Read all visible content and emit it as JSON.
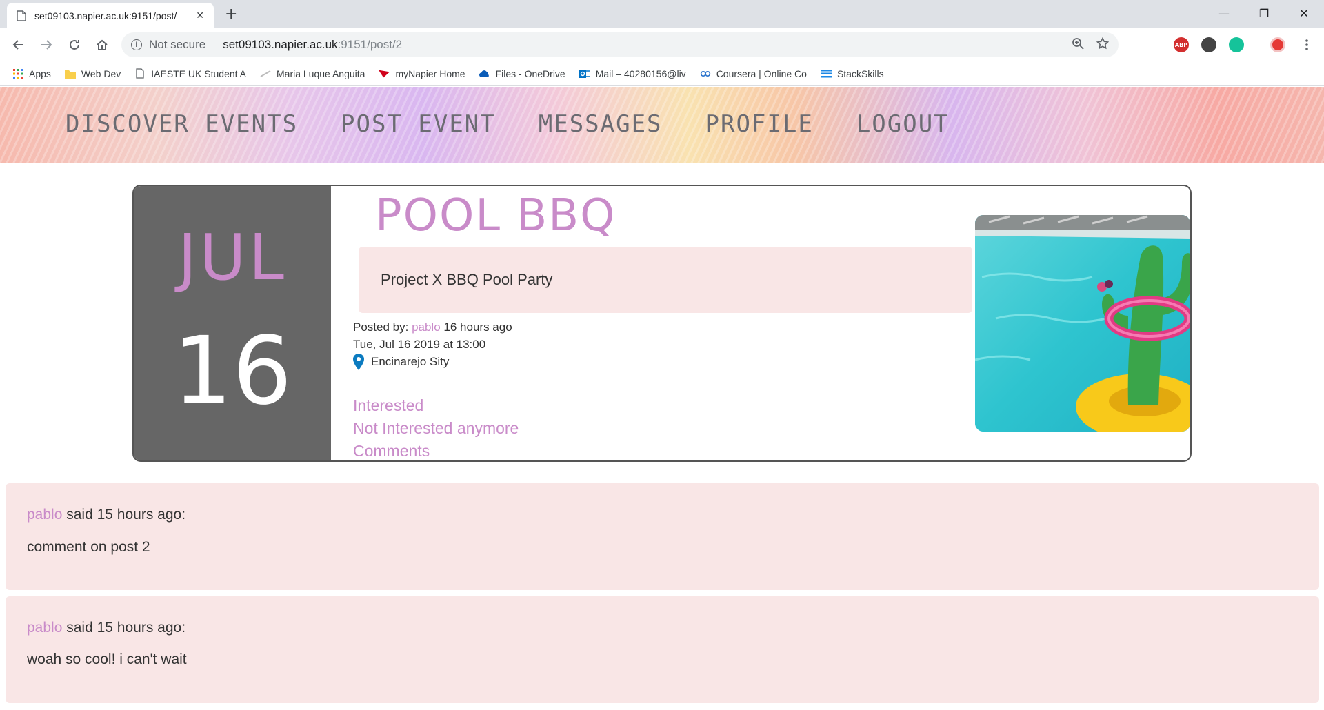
{
  "browser": {
    "tab_title": "set09103.napier.ac.uk:9151/post/",
    "tab_close": "✕",
    "new_tab": "+",
    "security_label": "Not secure",
    "url_host": "set09103.napier.ac.uk",
    "url_path": ":9151/post/2",
    "window_controls": {
      "minimize": "—",
      "maximize": "❐",
      "close": "✕"
    },
    "bookmarks": [
      {
        "label": "Apps",
        "icon": "apps-grid-icon"
      },
      {
        "label": "Web Dev",
        "icon": "folder-icon"
      },
      {
        "label": "IAESTE UK Student A",
        "icon": "page-icon"
      },
      {
        "label": "Maria Luque Anguita",
        "icon": "arrow-icon"
      },
      {
        "label": "myNapier Home",
        "icon": "napier-icon"
      },
      {
        "label": "Files - OneDrive",
        "icon": "onedrive-icon"
      },
      {
        "label": "Mail – 40280156@liv",
        "icon": "outlook-icon"
      },
      {
        "label": "Coursera | Online Co",
        "icon": "coursera-icon"
      },
      {
        "label": "StackSkills",
        "icon": "stackskills-icon"
      }
    ],
    "extension_labels": {
      "abp": "ABP"
    }
  },
  "site_nav": {
    "items": [
      "Discover events",
      "Post event",
      "Messages",
      "Profile",
      "LOGOUT"
    ]
  },
  "event": {
    "month": "JUL",
    "day": "16",
    "title": "POOL BBQ",
    "description": "Project X BBQ Pool Party",
    "posted_by_label": "Posted by:",
    "posted_by_user": "pablo",
    "posted_ago": "16 hours ago",
    "datetime": "Tue, Jul 16 2019 at 13:00",
    "location": "Encinarejo Sity",
    "actions": {
      "interested": "Interested",
      "not_interested": "Not Interested anymore",
      "comments": "Comments"
    },
    "image_icon": "pool-cactus-ring-image"
  },
  "comments": [
    {
      "user": "pablo",
      "said": "said 15 hours ago:",
      "text": "comment on post 2"
    },
    {
      "user": "pablo",
      "said": "said 15 hours ago:",
      "text": "woah so cool! i can't wait"
    }
  ],
  "colors": {
    "accent": "#c98bc9",
    "date_block": "#666666",
    "comment_bg": "#f9e6e6"
  }
}
